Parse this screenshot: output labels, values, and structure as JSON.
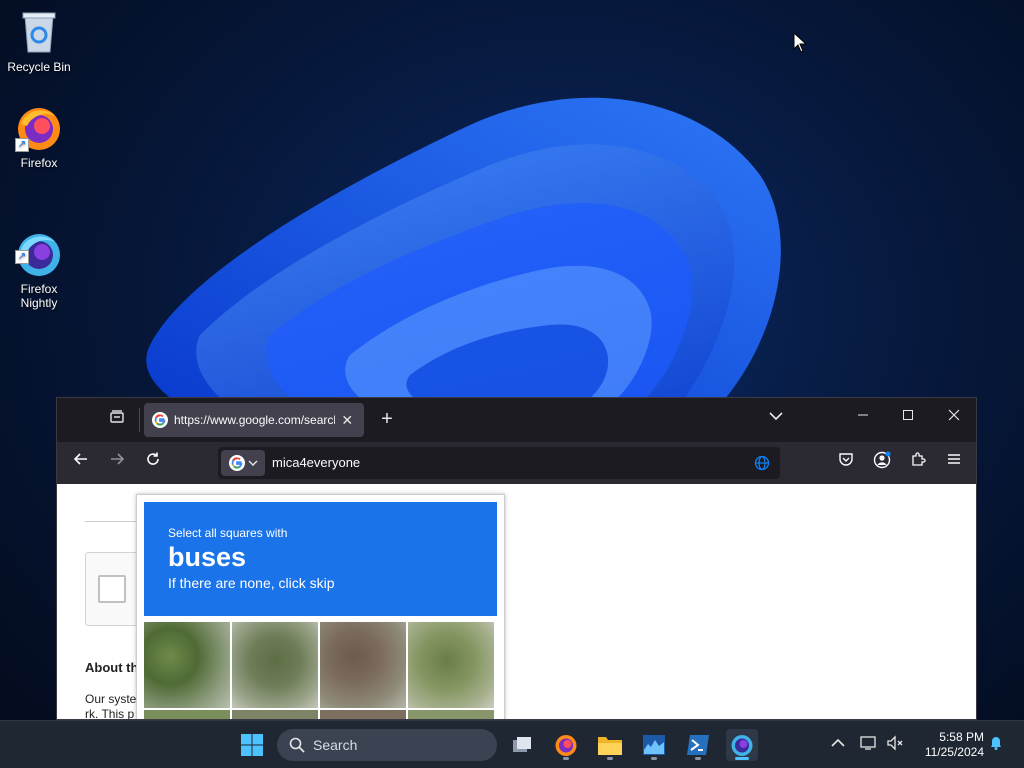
{
  "desktop": {
    "icons": [
      {
        "label": "Recycle Bin"
      },
      {
        "label": "Firefox"
      },
      {
        "label": "Firefox\nNightly"
      }
    ]
  },
  "browser": {
    "tab": {
      "title": "https://www.google.com/search"
    },
    "urlbar": {
      "value": "mica4everyone"
    },
    "page": {
      "about_heading": "About th",
      "about_text_1": "Our syste",
      "about_text_2": "rk. This p"
    },
    "captcha": {
      "instruction": "Select all squares with",
      "target": "buses",
      "hint": "If there are none, click skip"
    }
  },
  "taskbar": {
    "search_label": "Search",
    "time": "5:58 PM",
    "date": "11/25/2024"
  },
  "colors": {
    "captcha_header": "#1a73e8",
    "taskbar": "#1f2733",
    "browser_chrome": "#2b2a33"
  }
}
